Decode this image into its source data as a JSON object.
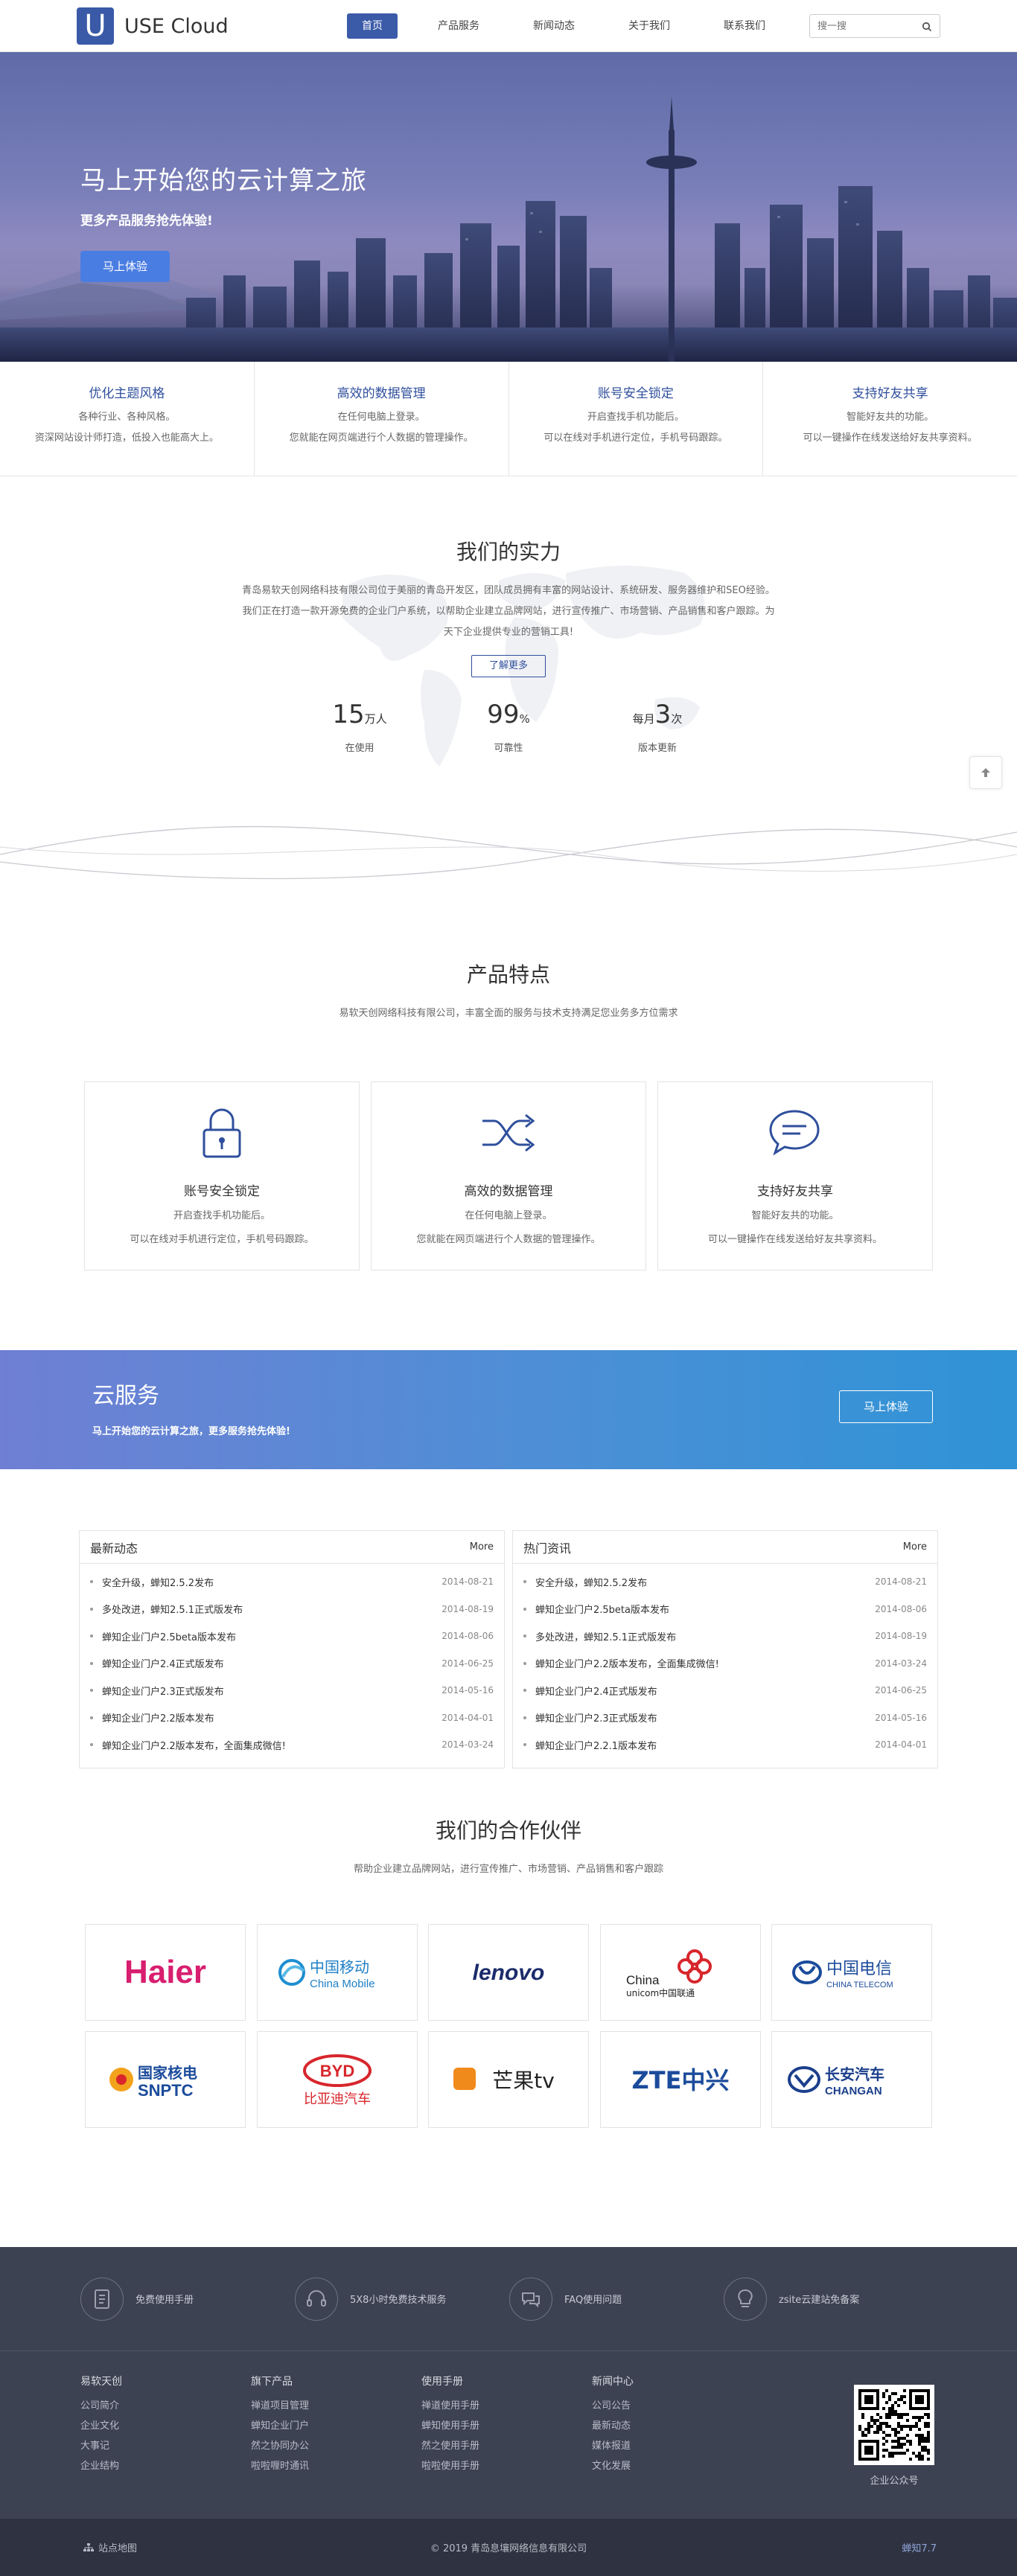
{
  "header": {
    "logo_letter": "U",
    "brand": "USE Cloud",
    "nav": [
      "首页",
      "产品服务",
      "新闻动态",
      "关于我们",
      "联系我们"
    ],
    "search_placeholder": "搜一搜"
  },
  "hero": {
    "title": "马上开始您的云计算之旅",
    "subtitle": "更多产品服务抢先体验!",
    "button": "马上体验"
  },
  "features": [
    {
      "title": "优化主题风格",
      "line1": "各种行业、各种风格。",
      "line2": "资深网站设计师打造，低投入也能高大上。"
    },
    {
      "title": "高效的数据管理",
      "line1": "在任何电脑上登录。",
      "line2": "您就能在网页端进行个人数据的管理操作。"
    },
    {
      "title": "账号安全锁定",
      "line1": "开启查找手机功能后。",
      "line2": "可以在线对手机进行定位，手机号码跟踪。"
    },
    {
      "title": "支持好友共享",
      "line1": "智能好友共的功能。",
      "line2": "可以一键操作在线发送给好友共享资料。"
    }
  ],
  "strength": {
    "title": "我们的实力",
    "desc1": "青岛易软天创网络科技有限公司位于美丽的青岛开发区，团队成员拥有丰富的网站设计、系统研发、服务器维护和SEO经验。",
    "desc2": "我们正在打造一款开源免费的企业门户系统，以帮助企业建立品牌网站，进行宣传推广、市场营销、产品销售和客户跟踪。为",
    "desc3": "天下企业提供专业的营销工具!",
    "more": "了解更多",
    "stats": [
      {
        "pre": "",
        "num": "15",
        "unit": "万人",
        "label": "在使用"
      },
      {
        "pre": "",
        "num": "99",
        "unit": "%",
        "label": "可靠性"
      },
      {
        "pre": "每月",
        "num": "3",
        "unit": "次",
        "label": "版本更新"
      }
    ]
  },
  "product": {
    "title": "产品特点",
    "subtitle": "易软天创网络科技有限公司，丰富全面的服务与技术支持满足您业务多方位需求",
    "cards": [
      {
        "icon": "lock-icon",
        "title": "账号安全锁定",
        "line1": "开启查找手机功能后。",
        "line2": "可以在线对手机进行定位，手机号码跟踪。"
      },
      {
        "icon": "shuffle-icon",
        "title": "高效的数据管理",
        "line1": "在任何电脑上登录。",
        "line2": "您就能在网页端进行个人数据的管理操作。"
      },
      {
        "icon": "chat-icon",
        "title": "支持好友共享",
        "line1": "智能好友共的功能。",
        "line2": "可以一键操作在线发送给好友共享资料。"
      }
    ]
  },
  "cloud": {
    "title": "云服务",
    "subtitle": "马上开始您的云计算之旅，更多服务抢先体验!",
    "button": "马上体验"
  },
  "news": {
    "left": {
      "title": "最新动态",
      "more": "More",
      "items": [
        {
          "text": "安全升级，蝉知2.5.2发布",
          "date": "2014-08-21"
        },
        {
          "text": "多处改进，蝉知2.5.1正式版发布",
          "date": "2014-08-19"
        },
        {
          "text": "蝉知企业门户2.5beta版本发布",
          "date": "2014-08-06"
        },
        {
          "text": "蝉知企业门户2.4正式版发布",
          "date": "2014-06-25"
        },
        {
          "text": "蝉知企业门户2.3正式版发布",
          "date": "2014-05-16"
        },
        {
          "text": "蝉知企业门户2.2版本发布",
          "date": "2014-04-01"
        },
        {
          "text": "蝉知企业门户2.2版本发布，全面集成微信!",
          "date": "2014-03-24"
        }
      ]
    },
    "right": {
      "title": "热门资讯",
      "more": "More",
      "items": [
        {
          "text": "安全升级，蝉知2.5.2发布",
          "date": "2014-08-21"
        },
        {
          "text": "蝉知企业门户2.5beta版本发布",
          "date": "2014-08-06"
        },
        {
          "text": "多处改进，蝉知2.5.1正式版发布",
          "date": "2014-08-19"
        },
        {
          "text": "蝉知企业门户2.2版本发布，全面集成微信!",
          "date": "2014-03-24"
        },
        {
          "text": "蝉知企业门户2.4正式版发布",
          "date": "2014-06-25"
        },
        {
          "text": "蝉知企业门户2.3正式版发布",
          "date": "2014-05-16"
        },
        {
          "text": "蝉知企业门户2.2.1版本发布",
          "date": "2014-04-01"
        }
      ]
    }
  },
  "partners": {
    "title": "我们的合作伙伴",
    "subtitle": "帮助企业建立品牌网站，进行宣传推广、市场营销、产品销售和客户跟踪",
    "logos": [
      "Haier",
      "中国移动",
      "China Mobile",
      "lenovo",
      "China",
      "unicom中国联通",
      "中国电信",
      "CHINA TELECOM",
      "国家核电",
      "SNPTC",
      "BYD",
      "比亚迪汽车",
      "芒果tv",
      "ZTE中兴",
      "长安汽车",
      "CHANGAN"
    ]
  },
  "footer": {
    "services": [
      "免费使用手册",
      "5X8小时免费技术服务",
      "FAQ使用问题",
      "zsite云建站免备案"
    ],
    "cols": [
      {
        "title": "易软天创",
        "links": [
          "公司简介",
          "企业文化",
          "大事记",
          "企业结构"
        ]
      },
      {
        "title": "旗下产品",
        "links": [
          "禅道项目管理",
          "蝉知企业门户",
          "然之协同办公",
          "啦啦喱时通讯"
        ]
      },
      {
        "title": "使用手册",
        "links": [
          "禅道使用手册",
          "蝉知使用手册",
          "然之使用手册",
          "啦啦使用手册"
        ]
      },
      {
        "title": "新闻中心",
        "links": [
          "公司公告",
          "最新动态",
          "媒体报道",
          "文化发展"
        ]
      }
    ],
    "qr_label": "企业公众号",
    "sitemap": "站点地图",
    "copyright": "© 2019 青岛息壤网络信息有限公司",
    "version": "蝉知7.7"
  },
  "colors": {
    "primary": "#3b5aa8",
    "footer": "#3d4252",
    "bottom": "#2f3341"
  }
}
